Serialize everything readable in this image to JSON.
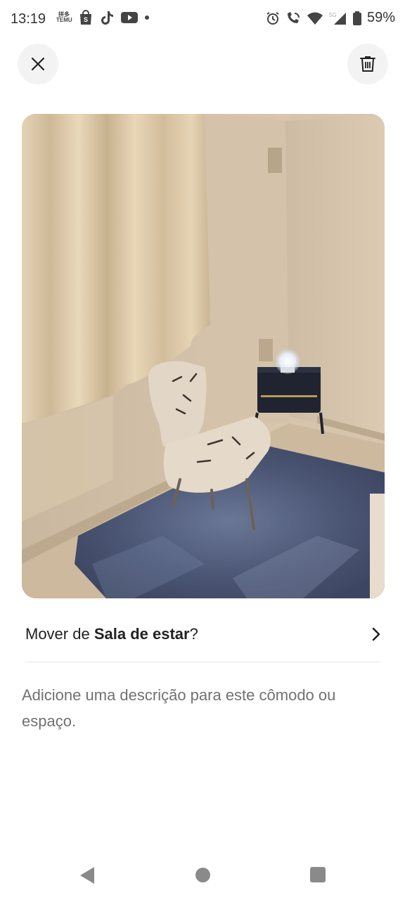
{
  "status_bar": {
    "time": "13:19",
    "temu_label_top": "拼多",
    "temu_label_bottom": "TEMU",
    "battery": "59%",
    "network": "5G"
  },
  "header": {
    "close_icon": "close-icon",
    "delete_icon": "trash-icon"
  },
  "photo": {
    "subject": "room-photo"
  },
  "move_row": {
    "prefix": "Mover de ",
    "room": "Sala de estar",
    "suffix": "?"
  },
  "description": {
    "text": "Adicione uma descrição para este cômodo ou espaço."
  },
  "nav": {
    "back": "back-icon",
    "home": "home-icon",
    "recents": "recents-icon"
  }
}
